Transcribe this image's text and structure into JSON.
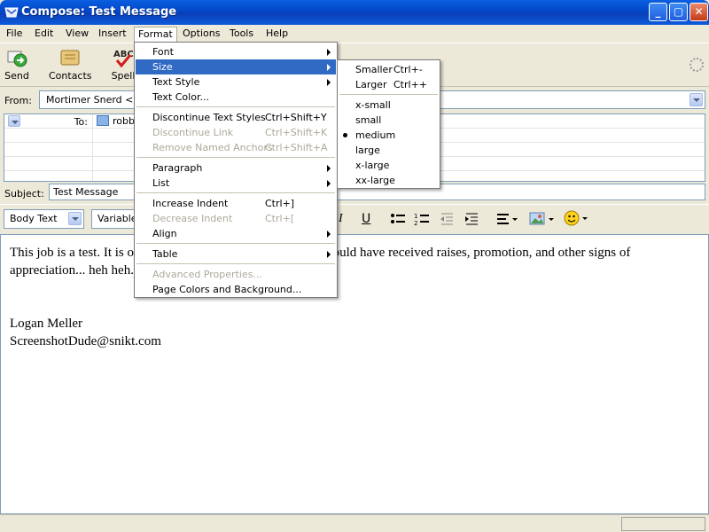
{
  "window": {
    "title": "Compose: Test Message",
    "minimize": "_",
    "maximize": "▢",
    "close": "✕"
  },
  "menubar": [
    "File",
    "Edit",
    "View",
    "Insert",
    "Format",
    "Options",
    "Tools",
    "Help"
  ],
  "toolbar": {
    "send": "Send",
    "contacts": "Contacts",
    "spell": "Spell"
  },
  "from": {
    "label": "From:",
    "value": "Mortimer Snerd <use"
  },
  "recipients": {
    "type": "To:",
    "value": "robb"
  },
  "subject": {
    "label": "Subject:",
    "value": "Test Message"
  },
  "format_toolbar": {
    "paragraph_style": "Body Text",
    "font": "Variable",
    "italic": "I",
    "underline": "U"
  },
  "body": {
    "line1": "This job is a test.  It is o",
    "line1_end": ", you would have received raises, promotion, and other signs of",
    "line2": "appreciation... heh heh.",
    "sig_name": "Logan Meller",
    "sig_email": "ScreenshotDude@snikt.com"
  },
  "format_menu": [
    {
      "label": "Font",
      "shortcut": "",
      "submenu": true,
      "disabled": false
    },
    {
      "label": "Size",
      "shortcut": "",
      "submenu": true,
      "disabled": false,
      "highlighted": true
    },
    {
      "label": "Text Style",
      "shortcut": "",
      "submenu": true,
      "disabled": false
    },
    {
      "label": "Text Color...",
      "shortcut": "",
      "submenu": false,
      "disabled": false
    },
    {
      "label": "Discontinue Text Styles",
      "shortcut": "Ctrl+Shift+Y",
      "submenu": false,
      "disabled": false
    },
    {
      "label": "Discontinue Link",
      "shortcut": "Ctrl+Shift+K",
      "submenu": false,
      "disabled": true
    },
    {
      "label": "Remove Named Anchors",
      "shortcut": "Ctrl+Shift+A",
      "submenu": false,
      "disabled": true
    },
    {
      "label": "Paragraph",
      "shortcut": "",
      "submenu": true,
      "disabled": false
    },
    {
      "label": "List",
      "shortcut": "",
      "submenu": true,
      "disabled": false
    },
    {
      "label": "Increase Indent",
      "shortcut": "Ctrl+]",
      "submenu": false,
      "disabled": false
    },
    {
      "label": "Decrease Indent",
      "shortcut": "Ctrl+[",
      "submenu": false,
      "disabled": true
    },
    {
      "label": "Align",
      "shortcut": "",
      "submenu": true,
      "disabled": false
    },
    {
      "label": "Table",
      "shortcut": "",
      "submenu": true,
      "disabled": false
    },
    {
      "label": "Advanced Properties...",
      "shortcut": "",
      "submenu": false,
      "disabled": true
    },
    {
      "label": "Page Colors and Background...",
      "shortcut": "",
      "submenu": false,
      "disabled": false
    }
  ],
  "size_menu": [
    {
      "label": "Smaller",
      "shortcut": "Ctrl+-"
    },
    {
      "label": "Larger",
      "shortcut": "Ctrl++"
    },
    {
      "label": "x-small",
      "shortcut": ""
    },
    {
      "label": "small",
      "shortcut": ""
    },
    {
      "label": "medium",
      "shortcut": "",
      "checked": true
    },
    {
      "label": "large",
      "shortcut": ""
    },
    {
      "label": "x-large",
      "shortcut": ""
    },
    {
      "label": "xx-large",
      "shortcut": ""
    }
  ],
  "colors": {
    "highlight": "#316ac5",
    "titlebar": "#0346c8",
    "chrome": "#ece9d8"
  }
}
